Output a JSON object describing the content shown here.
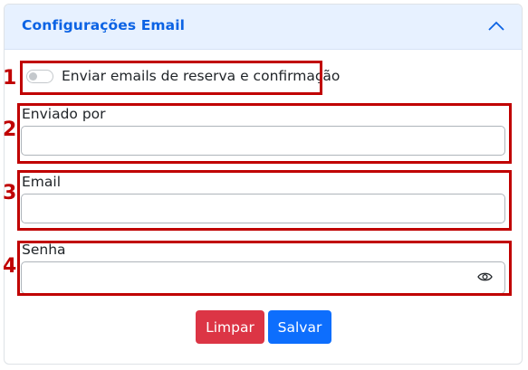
{
  "panel": {
    "title": "Configurações Email",
    "collapse_icon": "chevron-up-icon"
  },
  "toggle": {
    "label": "Enviar emails de reserva e confirmação",
    "checked": false
  },
  "fields": {
    "sent_by": {
      "label": "Enviado por",
      "value": ""
    },
    "email": {
      "label": "Email",
      "value": ""
    },
    "password": {
      "label": "Senha",
      "value": "",
      "icon": "eye-icon"
    }
  },
  "buttons": {
    "clear": "Limpar",
    "save": "Salvar"
  },
  "annotations": {
    "n1": "1",
    "n2": "2",
    "n3": "3",
    "n4": "4"
  },
  "colors": {
    "header_bg": "#e7f1ff",
    "header_text": "#0c63e4",
    "annotation": "#c00000",
    "clear_button": "#dc3545",
    "save_button": "#0d6efd"
  }
}
